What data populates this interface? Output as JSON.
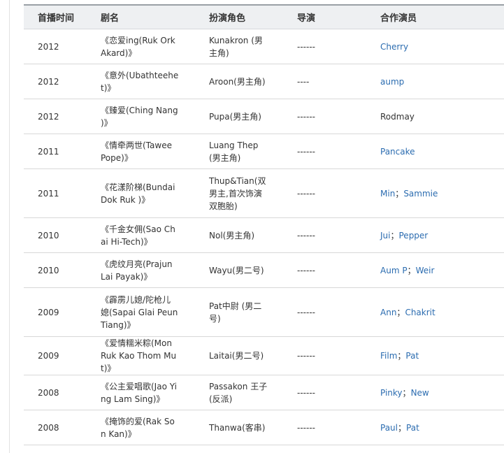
{
  "headers": [
    "首播时间",
    "剧名",
    "扮演角色",
    "导演",
    "合作演员"
  ],
  "rows": [
    {
      "year": "2012",
      "title": "《恋爱ing(Ruk Ork Akard)》",
      "role": "Kunakron (男主角)",
      "director": "------",
      "costars": [
        {
          "name": "Cherry",
          "link": true
        }
      ]
    },
    {
      "year": "2012",
      "title": "《意外(Ubathteehet)》",
      "role": "Aroon(男主角)",
      "director": "----",
      "costars": [
        {
          "name": "aump",
          "link": true
        }
      ]
    },
    {
      "year": "2012",
      "title": "《臻爱(Ching Nang )》",
      "role": "Pupa(男主角)",
      "director": "------",
      "costars": [
        {
          "name": "Rodmay",
          "link": false
        }
      ]
    },
    {
      "year": "2011",
      "title": "《情牵两世(Tawee Pope)》",
      "role": "Luang Thep (男主角)",
      "director": "------",
      "costars": [
        {
          "name": "Pancake",
          "link": true
        }
      ]
    },
    {
      "year": "2011",
      "title": "《花漾阶梯(Bundai Dok Ruk )》",
      "role": "Thup&Tian(双男主,首次饰演双胞胎)",
      "director": "------",
      "costars": [
        {
          "name": "Min",
          "link": true
        },
        {
          "name": "Sammie",
          "link": true
        }
      ]
    },
    {
      "year": "2010",
      "title": "《千金女佣(Sao Chai Hi-Tech)》",
      "role": "Nol(男主角)",
      "director": "------",
      "costars": [
        {
          "name": "Jui",
          "link": true
        },
        {
          "name": "Pepper",
          "link": true
        }
      ]
    },
    {
      "year": "2010",
      "title": "《虎纹月亮(Prajun Lai Payak)》",
      "role": "Wayu(男二号)",
      "director": "------",
      "costars": [
        {
          "name": "Aum P",
          "link": true
        },
        {
          "name": "Weir",
          "link": true
        }
      ]
    },
    {
      "year": "2009",
      "title": "《霹雳儿媳/陀枪儿媳(Sapai Glai Peun Tiang)》",
      "role": "Pat中尉 (男二号)",
      "director": "------",
      "costars": [
        {
          "name": "Ann",
          "link": true
        },
        {
          "name": "Chakrit",
          "link": true
        }
      ]
    },
    {
      "year": "2009",
      "title": "《爱情糯米粽(Mon Ruk Kao Thom Mut)》",
      "role": "Laitai(男二号)",
      "director": "------",
      "costars": [
        {
          "name": "Film",
          "link": true
        },
        {
          "name": "Pat",
          "link": true
        }
      ]
    },
    {
      "year": "2008",
      "title": "《公主爱唱歌(Jao Ying Lam Sing)》",
      "role": "Passakon 王子(反派)",
      "director": "------",
      "costars": [
        {
          "name": "Pinky",
          "link": true
        },
        {
          "name": "New",
          "link": true
        }
      ]
    },
    {
      "year": "2008",
      "title": "《掩饰的爱(Rak Son Kan)》",
      "role": "Thanwa(客串)",
      "director": "------",
      "costars": [
        {
          "name": "Paul",
          "link": true
        },
        {
          "name": "Pat",
          "link": true
        }
      ]
    }
  ],
  "costar_separator": "；"
}
